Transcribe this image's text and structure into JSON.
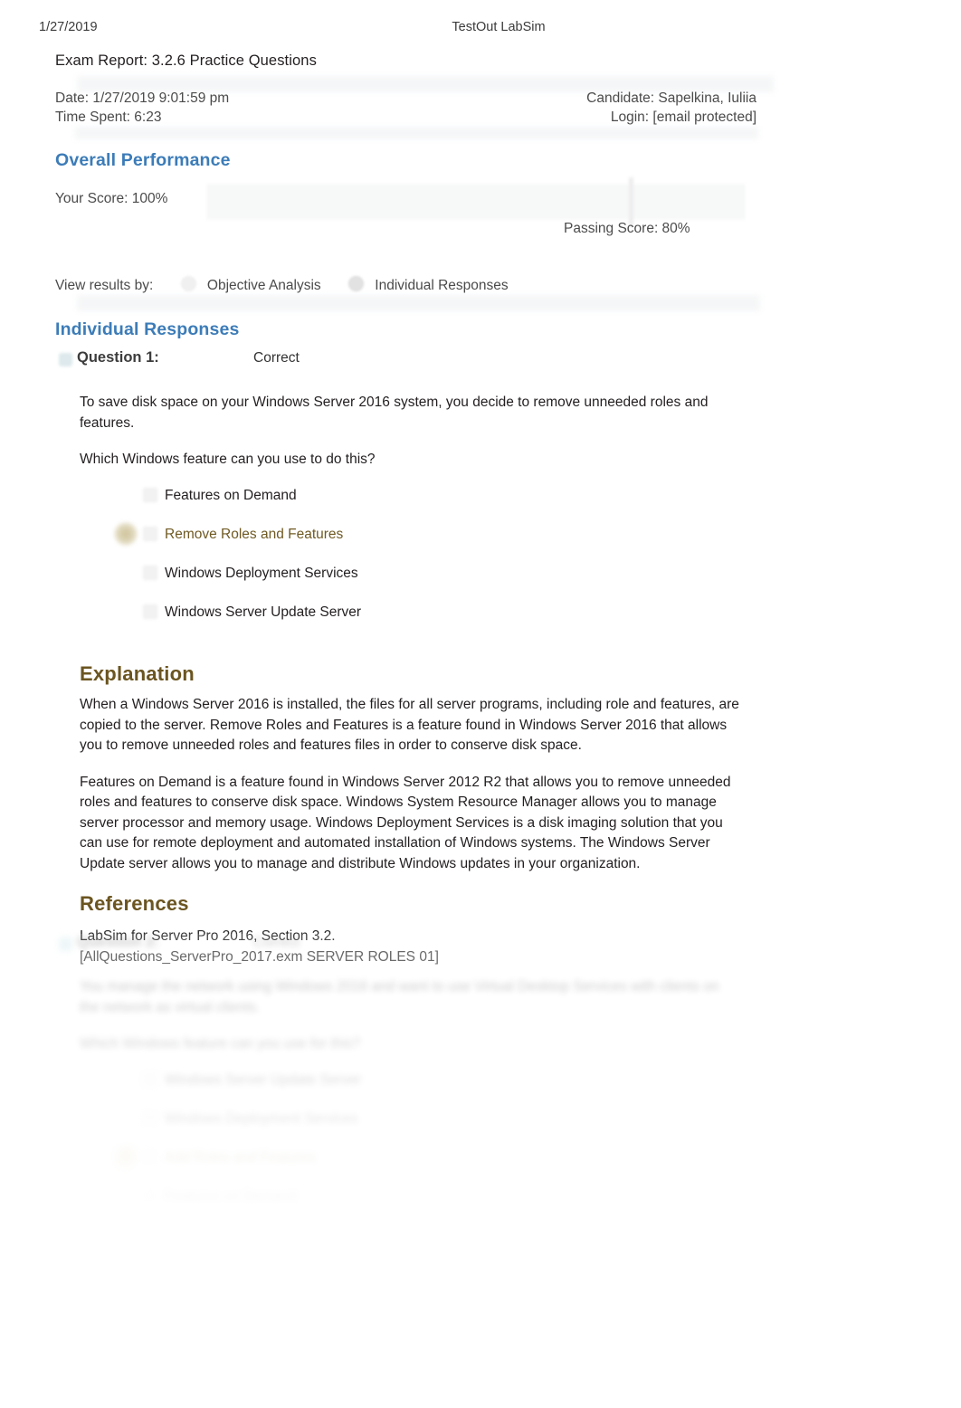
{
  "page_header": {
    "date": "1/27/2019",
    "app_title": "TestOut LabSim"
  },
  "exam": {
    "title": "Exam Report: 3.2.6 Practice Questions",
    "date_label": "Date: 1/27/2019 9:01:59 pm",
    "time_spent_label": "Time Spent: 6:23",
    "candidate_label": "Candidate: Sapelkina, Iuliia",
    "login_label": "Login: [email protected]"
  },
  "overall_performance": {
    "heading": "Overall Performance",
    "your_score_label": "Your Score: 100%",
    "passing_score_label": "Passing Score: 80%",
    "your_score_percent": 100,
    "passing_score_percent": 80
  },
  "view_results": {
    "label": "View results by:",
    "options": [
      {
        "label": "Objective Analysis",
        "selected": false
      },
      {
        "label": "Individual Responses",
        "selected": true
      }
    ]
  },
  "individual_responses": {
    "heading": "Individual Responses",
    "questions": [
      {
        "label": "Question 1:",
        "status": "Correct",
        "stem": [
          "To save disk space on your Windows Server 2016 system, you decide to remove unneeded roles and features.",
          "Which Windows feature can you use to do this?"
        ],
        "answers": [
          {
            "text": "Features on Demand",
            "chosen": false
          },
          {
            "text": "Remove Roles and Features",
            "chosen": true
          },
          {
            "text": "Windows Deployment Services",
            "chosen": false
          },
          {
            "text": "Windows Server Update Server",
            "chosen": false
          }
        ],
        "explanation_heading": "Explanation",
        "explanation": [
          "When a Windows Server 2016 is installed, the files for all server programs, including role and features, are copied to the server. Remove Roles and Features is a feature found in Windows Server 2016 that allows you to remove unneeded roles and features files in order to conserve disk space.",
          "Features on Demand is a feature found in Windows Server 2012 R2 that allows you to remove unneeded roles and features to conserve disk space. Windows System Resource Manager allows you to manage server processor and memory usage. Windows Deployment Services is a disk imaging solution that you can use for remote deployment and automated installation of Windows systems. The Windows Server Update server allows you to manage and distribute Windows updates in your organization."
        ],
        "references_heading": "References",
        "references": [
          "LabSim for Server Pro 2016, Section 3.2.",
          "[AllQuestions_ServerPro_2017.exm SERVER ROLES 01]"
        ]
      },
      {
        "label": "Question 2:",
        "status": "Correct",
        "stem": [
          "You manage the network using Windows 2016 and want to use Virtual Desktop Services with clients on the network as virtual clients.",
          "Which Windows feature can you use for this?"
        ],
        "answers": [
          {
            "text": "Windows Server Update Server",
            "chosen": false
          },
          {
            "text": "Windows Deployment Services",
            "chosen": false
          },
          {
            "text": "Add Roles and Features",
            "chosen": true
          },
          {
            "text": "Features on Demand",
            "chosen": false
          }
        ]
      }
    ]
  },
  "colors": {
    "section_heading_blue": "#3c7cb8",
    "subheading_brown": "#6b5520",
    "correct_answer_text": "#6f5a23",
    "body_text": "#231f20"
  }
}
